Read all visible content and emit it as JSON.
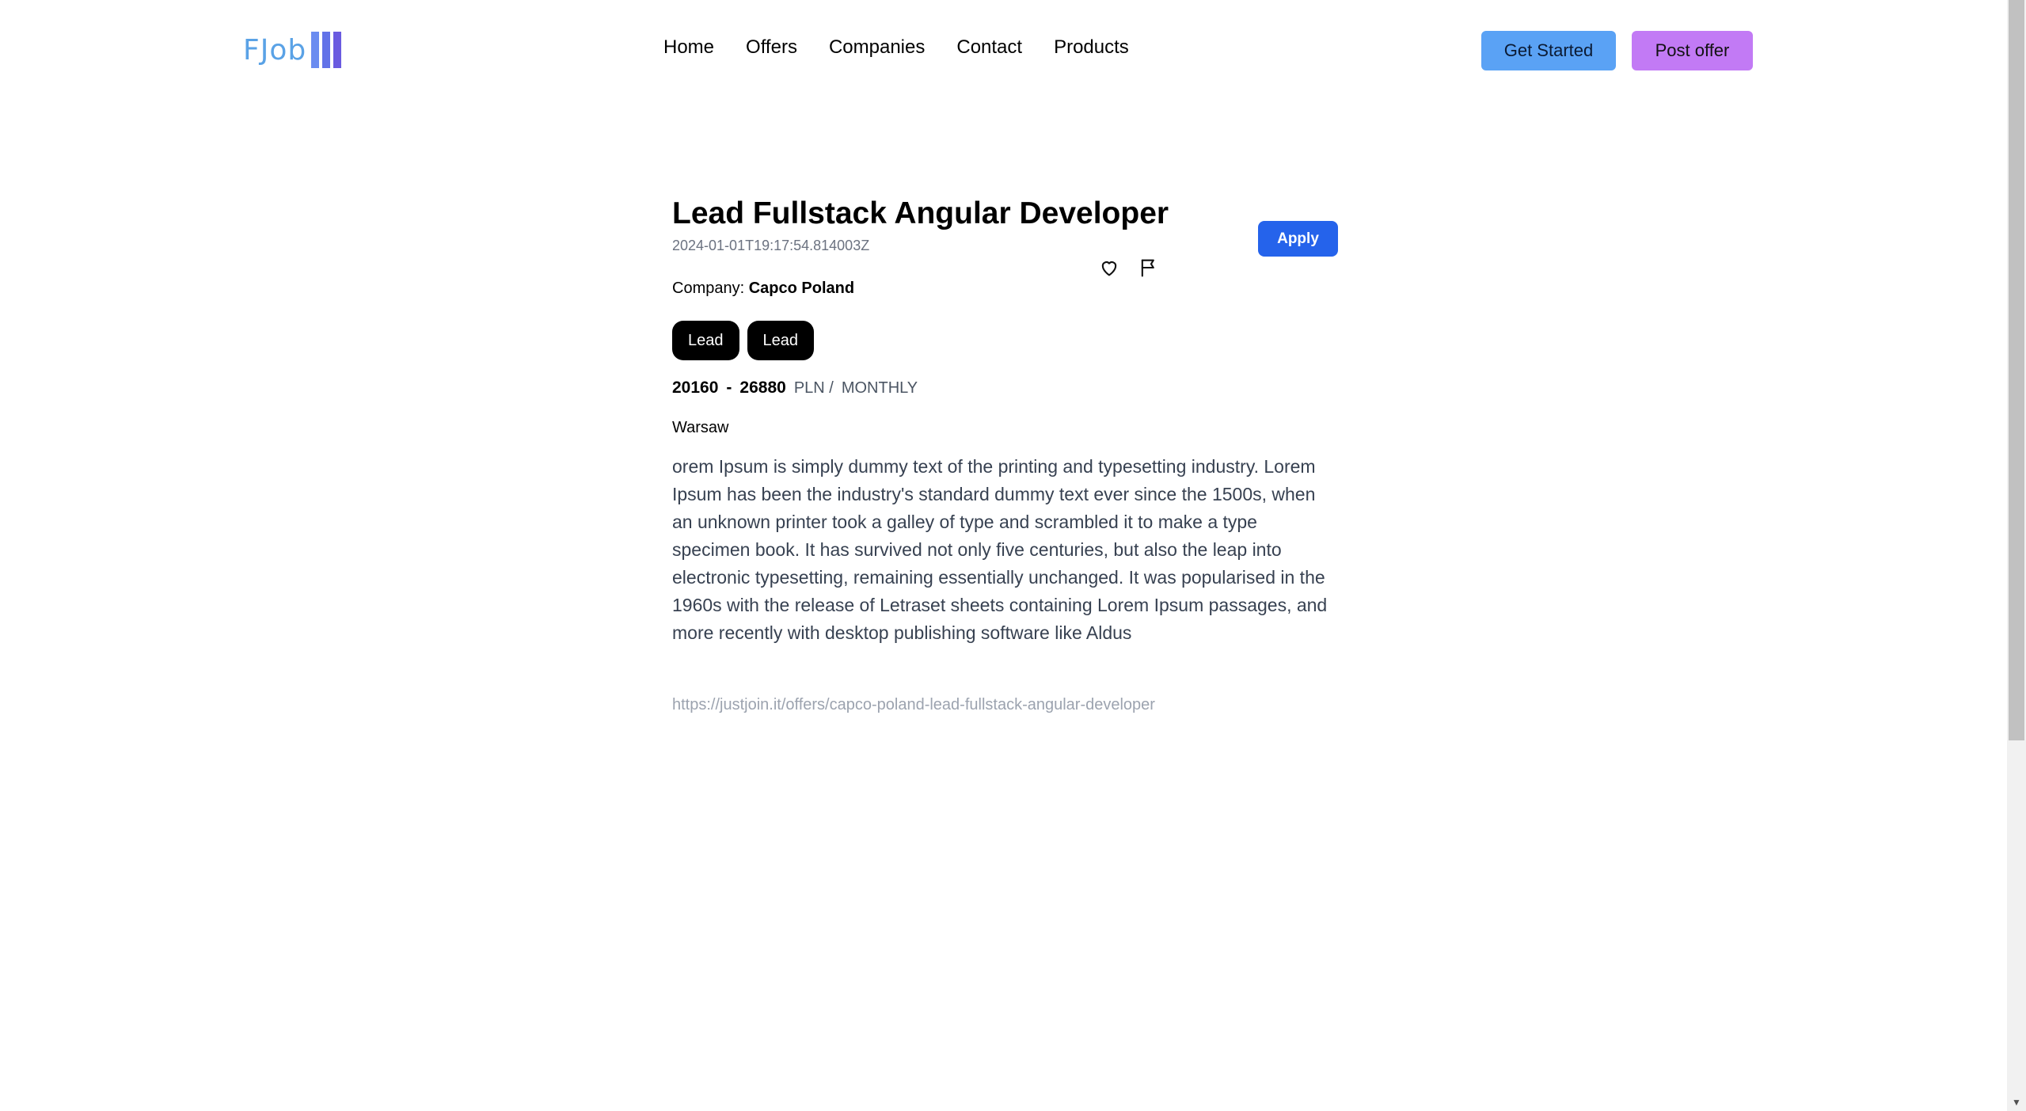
{
  "header": {
    "logo_text": "FJob",
    "nav": [
      "Home",
      "Offers",
      "Companies",
      "Contact",
      "Products"
    ],
    "get_started": "Get Started",
    "post_offer": "Post offer",
    "colors": {
      "get_started": "#5aa2f5",
      "post_offer": "#c27af5"
    }
  },
  "offer": {
    "title": "Lead Fullstack Angular Developer",
    "date": "2024-01-01T19:17:54.814003Z",
    "apply": "Apply",
    "company_label": "Company:",
    "company_name": "Capco Poland",
    "tags": [
      "Lead",
      "Lead"
    ],
    "salary_min": "20160",
    "salary_sep": "-",
    "salary_max": "26880",
    "currency": "PLN /",
    "period": "MONTHLY",
    "city": "Warsaw",
    "description": "orem Ipsum is simply dummy text of the printing and typesetting industry. Lorem Ipsum has been the industry's standard dummy text ever since the 1500s, when an unknown printer took a galley of type and scrambled it to make a type specimen book. It has survived not only five centuries, but also the leap into electronic typesetting, remaining essentially unchanged. It was popularised in the 1960s with the release of Letraset sheets containing Lorem Ipsum passages, and more recently with desktop publishing software like Aldus",
    "url": "https://justjoin.it/offers/capco-poland-lead-fullstack-angular-developer",
    "icons": [
      "heart-icon",
      "flag-icon"
    ],
    "apply_color": "#2563eb"
  }
}
